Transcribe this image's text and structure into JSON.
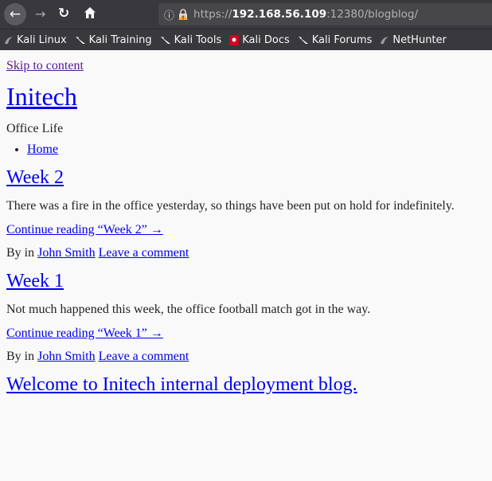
{
  "browser": {
    "url_scheme": "https://",
    "url_host": "192.168.56.109",
    "url_rest": ":12380/blogblog/",
    "bookmarks": [
      {
        "label": "Kali Linux"
      },
      {
        "label": "Kali Training"
      },
      {
        "label": "Kali Tools"
      },
      {
        "label": "Kali Docs"
      },
      {
        "label": "Kali Forums"
      },
      {
        "label": "NetHunter"
      }
    ]
  },
  "site": {
    "skip_link": "Skip to content",
    "title": "Initech",
    "description": "Office Life",
    "nav": [
      "Home"
    ]
  },
  "posts": [
    {
      "title": "Week 2",
      "excerpt": "There was a fire in the office yesterday, so things have been put on hold for indefinitely.",
      "more": "Continue reading “Week 2” →",
      "by": "By in",
      "author": "John Smith",
      "comment": "Leave a comment"
    },
    {
      "title": "Week 1",
      "excerpt": "Not much happened this week, the office football match got in the way.",
      "more": "Continue reading “Week 1” →",
      "by": "By in",
      "author": "John Smith",
      "comment": "Leave a comment"
    },
    {
      "title": "Welcome to Initech internal deployment blog."
    }
  ]
}
